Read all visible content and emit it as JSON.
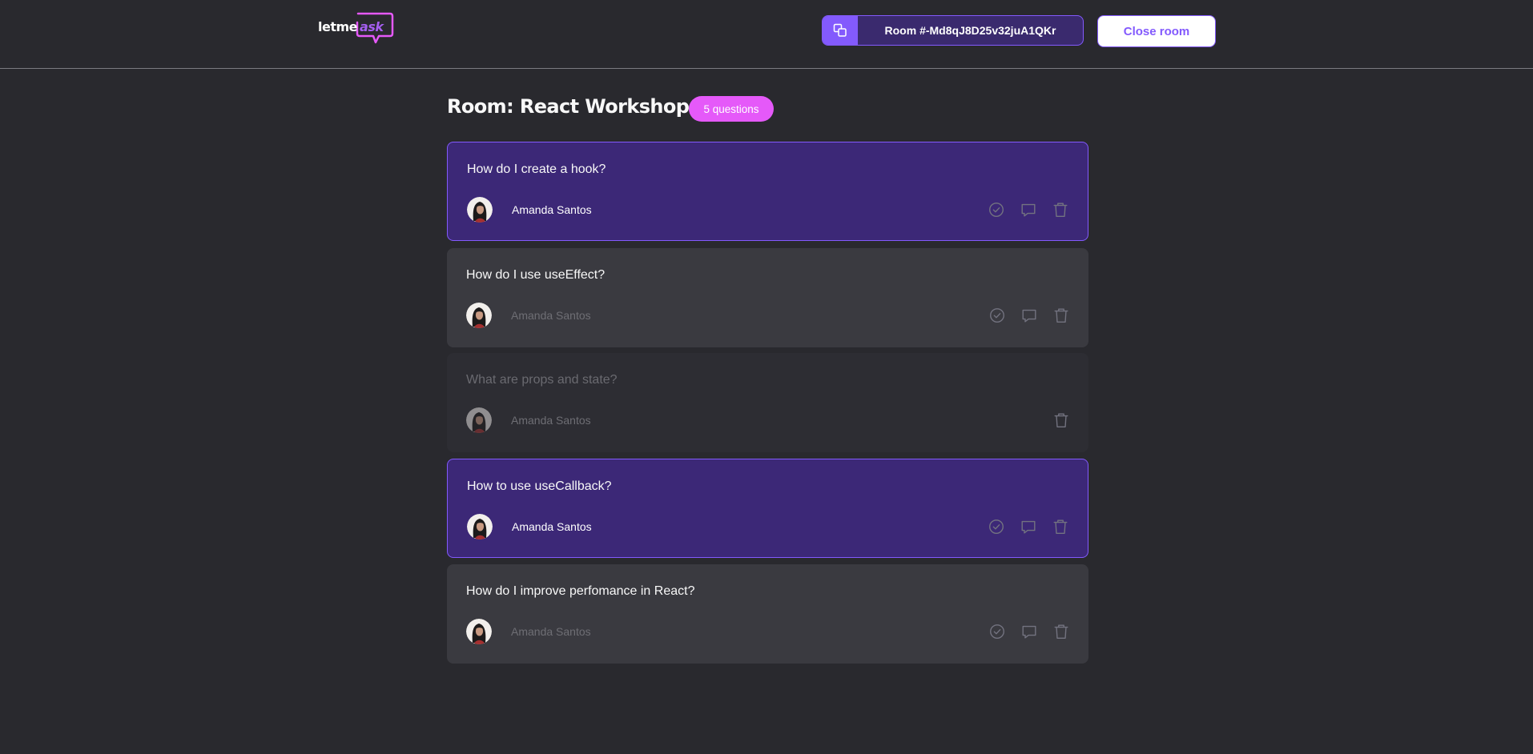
{
  "header": {
    "logo": {
      "text_main": "letme",
      "text_accent": "ask"
    },
    "room_code": {
      "label": "Room #-Md8qJ8D25v32juA1QKr",
      "icon": "copy-icon"
    },
    "close_room_label": "Close room"
  },
  "room": {
    "title": "Room: React Workshop",
    "question_count": "5 questions"
  },
  "questions": [
    {
      "text": "How do I create a hook?",
      "author": "Amanda Santos",
      "state": "highlighted"
    },
    {
      "text": "How do I use useEffect?",
      "author": "Amanda Santos",
      "state": "normal"
    },
    {
      "text": "What are props and state?",
      "author": "Amanda Santos",
      "state": "answered"
    },
    {
      "text": "How to use useCallback?",
      "author": "Amanda Santos",
      "state": "highlighted"
    },
    {
      "text": "How do I improve perfomance in React?",
      "author": "Amanda Santos",
      "state": "normal"
    }
  ],
  "icons": {
    "answered": "check-circle-icon",
    "highlight": "message-icon",
    "delete": "trash-icon"
  },
  "colors": {
    "background": "#29292e",
    "primary": "#835afd",
    "pink": "#e559f9",
    "highlighted_bg": "#3c2877",
    "card_bg": "#3a3a40"
  }
}
